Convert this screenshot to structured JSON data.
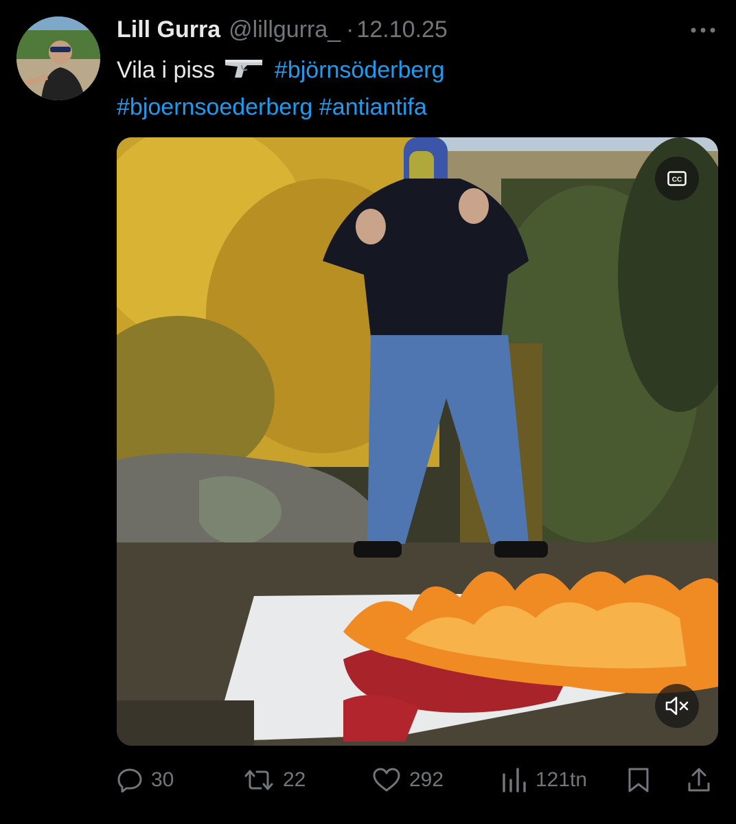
{
  "tweet": {
    "display_name": "Lill Gurra",
    "handle": "@lillgurra_",
    "separator": "·",
    "timestamp": "12.10.25",
    "text_plain": "Vila i piss",
    "hashtags": [
      "#björnsöderberg",
      "#bjoernsoederberg",
      "#antiantifa"
    ],
    "emoji_icon": "pistol-icon"
  },
  "media": {
    "cc_label": "CC",
    "type": "video"
  },
  "actions": {
    "replies": "30",
    "reposts": "22",
    "likes": "292",
    "views": "121tn"
  },
  "colors": {
    "background": "#000000",
    "primary_text": "#e7e9ea",
    "secondary_text": "#71767b",
    "link": "#1d9bf0"
  }
}
